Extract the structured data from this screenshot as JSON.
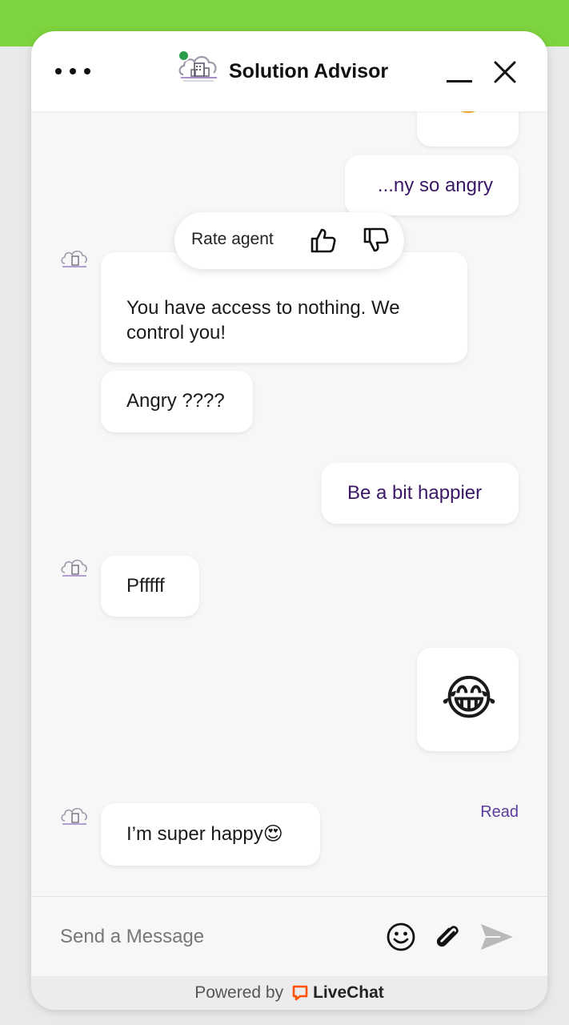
{
  "header": {
    "title": "Solution Advisor",
    "menu_icon": "more-dots-icon",
    "minimize_icon": "minimize-icon",
    "close_icon": "close-icon",
    "online_color": "#2a9c4a"
  },
  "rating": {
    "label": "Rate agent",
    "thumbs_up_icon": "thumbs-up-icon",
    "thumbs_down_icon": "thumbs-down-icon"
  },
  "messages": [
    {
      "from": "visitor",
      "text": "...ny so angry"
    },
    {
      "from": "agent",
      "text": "You have access to nothing. We control you!"
    },
    {
      "from": "agent",
      "text": "Angry ????"
    },
    {
      "from": "visitor",
      "text": "Be a bit happier"
    },
    {
      "from": "agent",
      "text": "Pfffff"
    },
    {
      "from": "visitor",
      "text": "😂",
      "status": "Read"
    },
    {
      "from": "agent",
      "text": "I’m super happy😍"
    }
  ],
  "composer": {
    "placeholder": "Send a Message",
    "emoji_icon": "emoji-icon",
    "attach_icon": "paperclip-icon",
    "send_icon": "send-icon"
  },
  "footer": {
    "powered_by": "Powered by",
    "brand": "LiveChat",
    "brand_color": "#ff5100"
  },
  "colors": {
    "top_bar": "#7ed43e",
    "visitor_text": "#3b1766",
    "read_status": "#5b3b9c"
  }
}
